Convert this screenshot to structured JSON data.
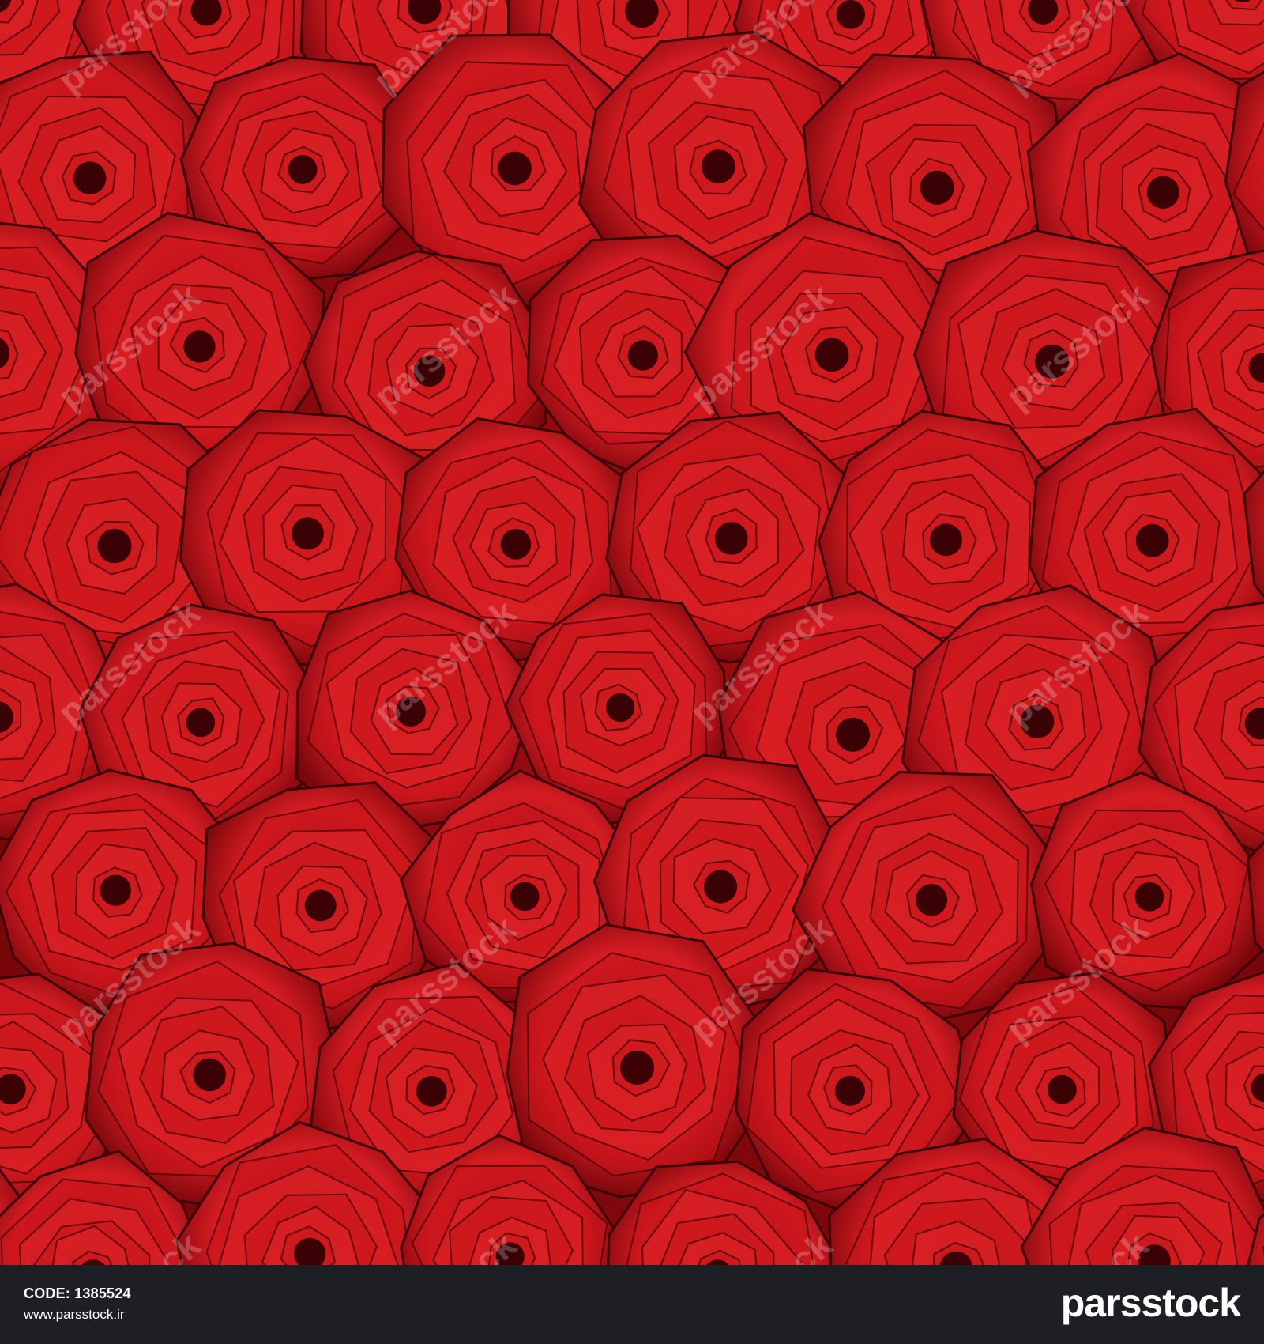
{
  "photo": {
    "subject": "red-roses",
    "colors": {
      "base": "#8d0a0b",
      "petal": "#c8141a",
      "highlight": "#e0262a",
      "shadow": "#3a0204"
    }
  },
  "footer": {
    "code_label": "CODE:",
    "code_value": "1385524",
    "url": "www.parsstock.ir",
    "logo": "parsstock",
    "background": "#1e1f24"
  },
  "watermark": {
    "text": "parsstock"
  }
}
